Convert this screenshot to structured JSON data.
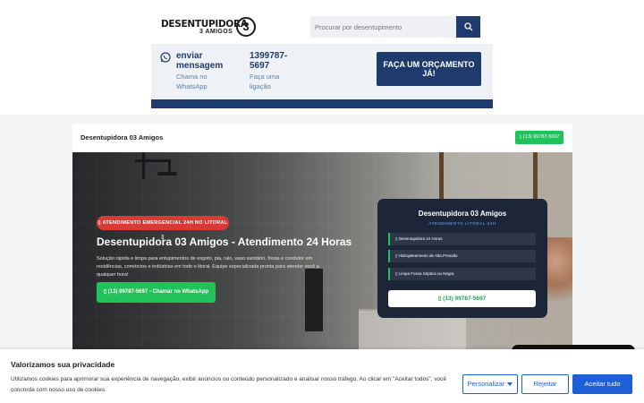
{
  "header": {
    "logo": {
      "line1": "DESENTUPIDORA",
      "line2": "3 AMIGOS",
      "mark": "3"
    },
    "search": {
      "placeholder": "Procurar por desentupimento"
    },
    "contact": {
      "whatsapp_title": "enviar mensagem",
      "whatsapp_sub": "Chama no WhatsApp",
      "phone_title": "1399787-5697",
      "phone_sub": "Faça uma ligação"
    },
    "quote_button": "FAÇA UM ORÇAMENTO JÁ!"
  },
  "card": {
    "title": "Desentupidora 03 Amigos",
    "phone_button": "▯ (13) 99787-5697"
  },
  "hero": {
    "badge": "▯ ATENDIMENTO EMERGENCIAL 24H NO LITORAL ▯",
    "title": "Desentupidora 03 Amigos - Atendimento 24 Horas",
    "description": "Solução rápida e limpa para entupimentos de esgoto, pia, ralo, vaso sanitário, fossa e condutor em residências, comércios e indústrias em todo o litoral. Equipe especializada pronta para atender você a qualquer hora!",
    "cta": "▯ (13) 99787-5697 - Chamar no WhatsApp"
  },
  "panel": {
    "title": "Desentupidora 03 Amigos",
    "subtitle": "ATENDIMENTO LITORAL 24H",
    "features": [
      "▯ Desentupidora 24 Horas",
      "▯ Hidrojateamento de Alta Pressão",
      "▯ Limpa Fossa Séptica ou Negra"
    ],
    "button": "▯ (13) 99787-5697"
  },
  "cookie": {
    "title": "Valorizamos sua privacidade",
    "text": "Utilizamos cookies para aprimorar sua experiência de navegação, exibir anúncios ou conteúdo personalizado e analisar nosso tráfego. Ao clicar em \"Aceitar todos\", você concorda com nosso uso de cookies.",
    "customize": "Personalizar",
    "reject": "Rejeitar",
    "accept": "Aceitar tudo"
  },
  "colors": {
    "brand_navy": "#1f3b6e",
    "whatsapp_green": "#21c25a",
    "emergency_red": "#d93a35",
    "cookie_blue": "#1c5fd6"
  },
  "icons": [
    "whatsapp-icon",
    "search-icon",
    "phone-icon",
    "chevron-down-icon"
  ]
}
